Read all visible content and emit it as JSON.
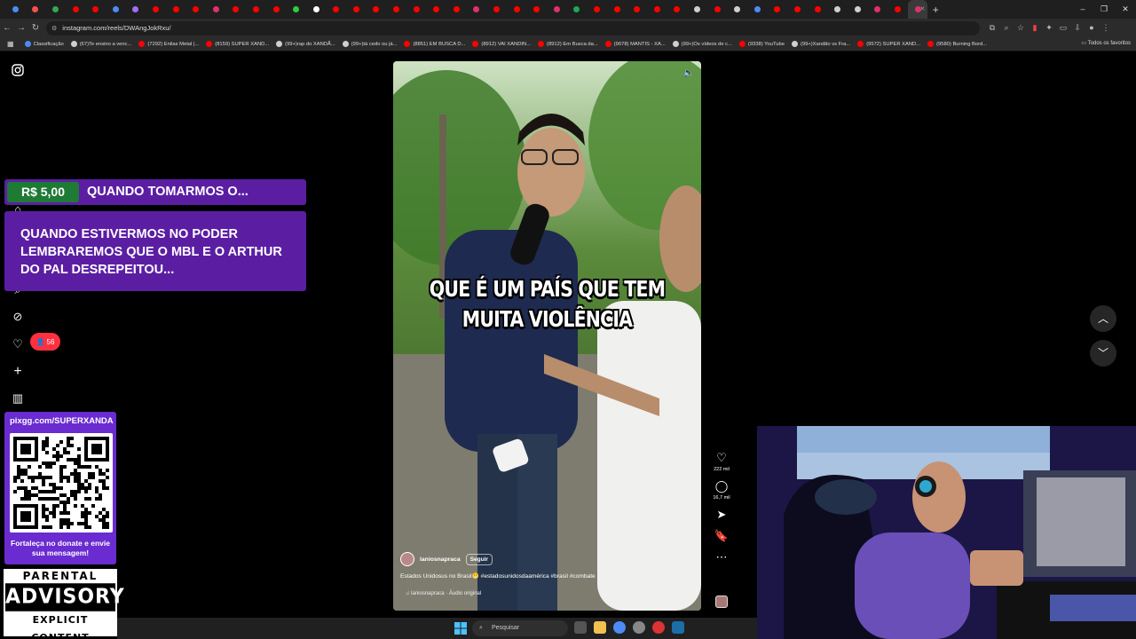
{
  "browser": {
    "url": "instagram.com/reels/DWAngJokRxu/",
    "tab_colors": [
      "#4c8bf5",
      "#ff4d4d",
      "#34a853",
      "#ff0000",
      "#ff0000",
      "#4c8bf5",
      "#a36cf5",
      "#ff0000",
      "#ff0000",
      "#ff0000",
      "#e1306c",
      "#ff0000",
      "#ff0000",
      "#ff0000",
      "#2ecc40",
      "#ffffff",
      "#ff0000",
      "#ff0000",
      "#ff0000",
      "#ff0000",
      "#ff0000",
      "#ff0000",
      "#ff0000",
      "#e1306c",
      "#ff0000",
      "#ff0000",
      "#ff0000",
      "#e1306c",
      "#1da851",
      "#ff0000",
      "#ff0000",
      "#ff0000",
      "#ff0000",
      "#ff0000",
      "#cfcfcf",
      "#ff0000",
      "#cfcfcf",
      "#4c8bf5",
      "#ff0000",
      "#ff0000",
      "#ff0000",
      "#cfcfcf",
      "#cfcfcf",
      "#e1306c",
      "#ff0000",
      "#e1306c"
    ],
    "bookmarks": [
      {
        "label": "Classificação",
        "color": "#4c8bf5"
      },
      {
        "label": "(67)Te ensino a venc...",
        "color": "#cfcfcf"
      },
      {
        "label": "(7292) Enilas Metal |...",
        "color": "#ff0000"
      },
      {
        "label": "(8159) SUPER XAND...",
        "color": "#ff0000"
      },
      {
        "label": "(99+)rap do XANDÃ...",
        "color": "#cfcfcf"
      },
      {
        "label": "(99+)tá cedo ou já...",
        "color": "#cfcfcf"
      },
      {
        "label": "(8851) EM BUSCA D...",
        "color": "#ff0000"
      },
      {
        "label": "(8912) VAI XANDIN...",
        "color": "#ff0000"
      },
      {
        "label": "(8912) Em Busca da...",
        "color": "#ff0000"
      },
      {
        "label": "(9078) MANTIS - XA...",
        "color": "#ff0000"
      },
      {
        "label": "(99+)Os vídeos de c...",
        "color": "#cfcfcf"
      },
      {
        "label": "(9338) YouTube",
        "color": "#ff0000"
      },
      {
        "label": "(99+)Xandão vs Fra...",
        "color": "#cfcfcf"
      },
      {
        "label": "(9572) SUPER XAND...",
        "color": "#ff0000"
      },
      {
        "label": "(9580) Burning Bord...",
        "color": "#ff0000"
      }
    ],
    "all_favorites": "Todos os favoritos"
  },
  "reel": {
    "caption": "QUE É UM PAÍS QUE TEM MUITA VIOLÊNCIA",
    "author": "laniosnapraca",
    "follow_label": "Seguir",
    "description": "Estados Unidosus no Brasil😬 #estadosunidosdaamérica #brasil #combate",
    "audio": "laniosnapraca · Áudio original",
    "likes": "222 mil",
    "comments": "16,7 mil"
  },
  "sidebar": {
    "notifications_count": "56"
  },
  "donation": {
    "amount": "R$ 5,00",
    "title": "QUANDO TOMARMOS O...",
    "message": "QUANDO ESTIVERMOS NO PODER LEMBRAREMOS QUE O MBL E O ARTHUR DO PAL DESREPEITOU..."
  },
  "pix": {
    "url": "pixgg.com/SUPERXANDA",
    "cta": "Fortaleça no donate e envie sua mensagem!"
  },
  "advisory": {
    "line1": "PARENTAL",
    "line2": "ADVISORY",
    "line3": "EXPLICIT CONTENT"
  },
  "taskbar": {
    "search_placeholder": "Pesquisar"
  }
}
